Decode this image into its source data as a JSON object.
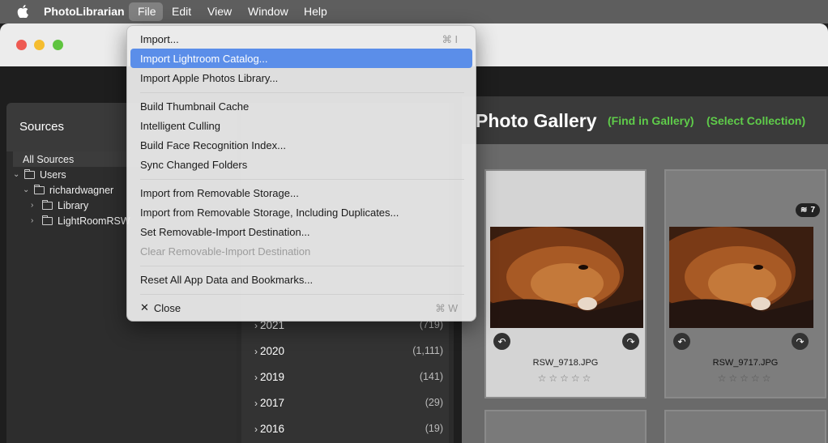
{
  "menubar": {
    "app_name": "PhotoLibrarian",
    "items": [
      "File",
      "Edit",
      "View",
      "Window",
      "Help"
    ]
  },
  "file_menu": {
    "items": [
      {
        "label": "Import...",
        "shortcut": "⌘ I"
      },
      {
        "label": "Import Lightroom Catalog...",
        "highlighted": true
      },
      {
        "label": "Import Apple Photos Library..."
      },
      {
        "label": "Build Thumbnail Cache"
      },
      {
        "label": "Intelligent Culling"
      },
      {
        "label": "Build Face Recognition Index..."
      },
      {
        "label": "Sync Changed Folders"
      },
      {
        "label": "Import from Removable Storage..."
      },
      {
        "label": "Import from Removable Storage, Including Duplicates..."
      },
      {
        "label": "Set Removable-Import Destination..."
      },
      {
        "label": "Clear Removable-Import Destination",
        "disabled": true
      },
      {
        "label": "Reset All App Data and Bookmarks..."
      },
      {
        "label": "Close",
        "shortcut": "⌘ W"
      }
    ]
  },
  "sources": {
    "title": "Sources",
    "tree": [
      "All Sources",
      "Users",
      "richardwagner",
      "Library",
      "LightRoomRSW"
    ]
  },
  "dates": {
    "years": [
      {
        "year": "2021",
        "count": "(719)"
      },
      {
        "year": "2020",
        "count": "(1,111)"
      },
      {
        "year": "2019",
        "count": "(141)"
      },
      {
        "year": "2017",
        "count": "(29)"
      },
      {
        "year": "2016",
        "count": "(19)"
      }
    ]
  },
  "gallery": {
    "title": "Photo Gallery",
    "find_link": "(Find in Gallery)",
    "select_link": "(Select Collection)",
    "cards": [
      {
        "filename": "RSW_9718.JPG",
        "stars": "☆☆☆☆☆",
        "rating": 0
      },
      {
        "filename": "RSW_9717.JPG",
        "stars": "☆☆☆☆☆",
        "rating": 0,
        "stack_count": "7"
      }
    ]
  },
  "colors": {
    "accent_highlight": "#5b8ee9",
    "link_green": "#5fcc4a"
  }
}
